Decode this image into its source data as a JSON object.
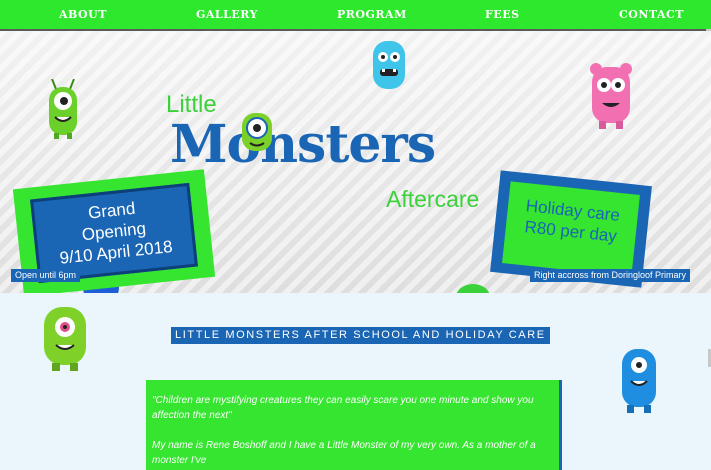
{
  "nav": {
    "items": [
      {
        "label": "ABOUT"
      },
      {
        "label": "GALLERY"
      },
      {
        "label": "PROGRAM"
      },
      {
        "label": "FEES"
      },
      {
        "label": "CONTACT"
      }
    ]
  },
  "hero": {
    "logo": {
      "little": "Little",
      "monsters": "Monsters",
      "aftercare": "Aftercare"
    },
    "grand_opening": {
      "line1": "Grand",
      "line2": "Opening",
      "line3": "9/10 April 2018"
    },
    "holiday_care": {
      "line1": "Holiday care",
      "line2": "R80 per day"
    },
    "tag_open": "Open until 6pm",
    "tag_location": "Right accross from Doringloof Primary"
  },
  "content": {
    "heading": "LITTLE MONSTERS AFTER SCHOOL AND HOLIDAY CARE",
    "quote": "\"Children are mystifying creatures they can easily scare you one minute and show you affection the next\"",
    "intro": "My name is Rene Boshoff and I have a Little Monster of my very own. As a mother of a monster I've"
  },
  "colors": {
    "nav_green": "#2ee82e",
    "brand_blue": "#1a66b5",
    "brand_green": "#35e52f",
    "page_bg": "#eaf6fc"
  }
}
